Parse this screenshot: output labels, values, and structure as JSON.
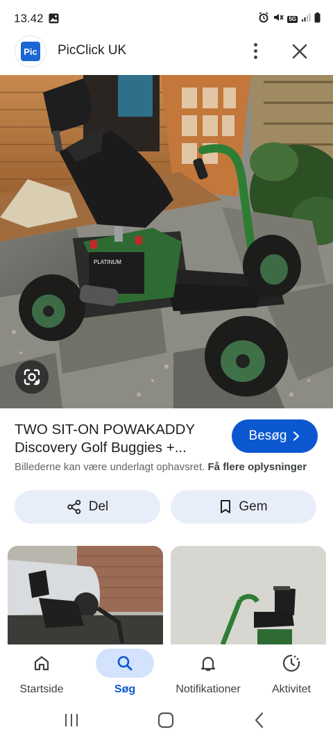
{
  "status_bar": {
    "time": "13.42",
    "network_badge": "5G"
  },
  "header": {
    "logo_text": "Pic",
    "site_name": "PicClick UK"
  },
  "result": {
    "title_line1": "TWO SIT-ON POWAKADDY",
    "title_line2": "Discovery Golf Buggies +...",
    "visit_label": "Besøg",
    "copyright_text": "Billederne kan være underlagt ophavsret.",
    "more_info_label": "Få flere oplysninger",
    "share_label": "Del",
    "save_label": "Gem",
    "battery_label": "PLATINUM"
  },
  "bottom_nav": {
    "items": [
      {
        "label": "Startside",
        "icon": "home-icon",
        "active": false
      },
      {
        "label": "Søg",
        "icon": "search-icon",
        "active": true
      },
      {
        "label": "Notifikationer",
        "icon": "bell-icon",
        "active": false
      },
      {
        "label": "Aktivitet",
        "icon": "activity-icon",
        "active": false
      }
    ]
  },
  "colors": {
    "accent": "#0b57d0",
    "pill_bg": "#e8eef9",
    "active_nav_bg": "#d3e3fd",
    "buggy_green": "#2e6b33"
  }
}
